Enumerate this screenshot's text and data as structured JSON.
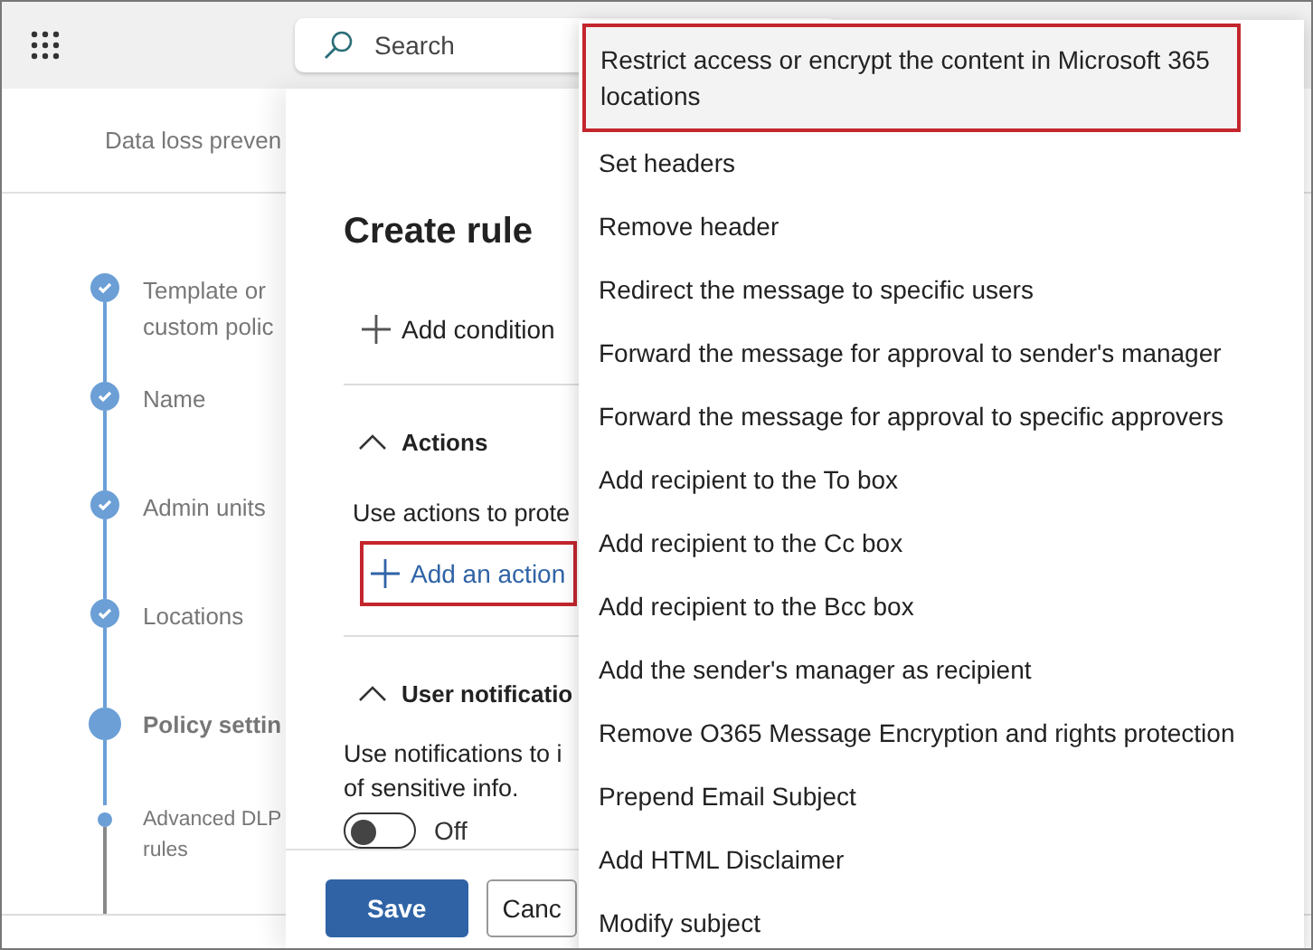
{
  "top_bar": {
    "search": {
      "placeholder": "Search"
    }
  },
  "breadcrumb": "Data loss preven",
  "steps": [
    {
      "label": "Template or\ncustom polic",
      "kind": "done"
    },
    {
      "label": "Name",
      "kind": "done"
    },
    {
      "label": "Admin units",
      "kind": "done"
    },
    {
      "label": "Locations",
      "kind": "done"
    },
    {
      "label": "Policy settin",
      "kind": "current"
    },
    {
      "label": "Advanced DLP\nrules",
      "kind": "sub"
    }
  ],
  "panel": {
    "title": "Create rule",
    "add_condition": {
      "label": "Add condition"
    },
    "sections": [
      {
        "title": "Actions",
        "expanded": true,
        "description": "Use actions to prote",
        "action": {
          "label": "Add an action",
          "annotated": true
        }
      },
      {
        "title": "User notificatio",
        "expanded": true,
        "description": "Use notifications to i\nof sensitive info.",
        "toggle": {
          "on": false,
          "label": "Off"
        }
      }
    ],
    "buttons": [
      {
        "label": "Save",
        "kind": "primary"
      },
      {
        "label": "Canc",
        "kind": "secondary"
      }
    ]
  },
  "menu": {
    "items": [
      {
        "label": "Restrict access or encrypt the content in Microsoft 365 locations",
        "selected": true,
        "annotated": true
      },
      {
        "label": "Set headers",
        "selected": false,
        "annotated": false
      },
      {
        "label": "Remove header",
        "selected": false,
        "annotated": false
      },
      {
        "label": "Redirect the message to specific users",
        "selected": false,
        "annotated": false
      },
      {
        "label": "Forward the message for approval to sender's manager",
        "selected": false,
        "annotated": false
      },
      {
        "label": "Forward the message for approval to specific approvers",
        "selected": false,
        "annotated": false
      },
      {
        "label": "Add recipient to the To box",
        "selected": false,
        "annotated": false
      },
      {
        "label": "Add recipient to the Cc box",
        "selected": false,
        "annotated": false
      },
      {
        "label": "Add recipient to the Bcc box",
        "selected": false,
        "annotated": false
      },
      {
        "label": "Add the sender's manager as recipient",
        "selected": false,
        "annotated": false
      },
      {
        "label": "Remove O365 Message Encryption and rights protection",
        "selected": false,
        "annotated": false
      },
      {
        "label": "Prepend Email Subject",
        "selected": false,
        "annotated": false
      },
      {
        "label": "Add HTML Disclaimer",
        "selected": false,
        "annotated": false
      },
      {
        "label": "Modify subject",
        "selected": false,
        "annotated": false
      }
    ]
  }
}
